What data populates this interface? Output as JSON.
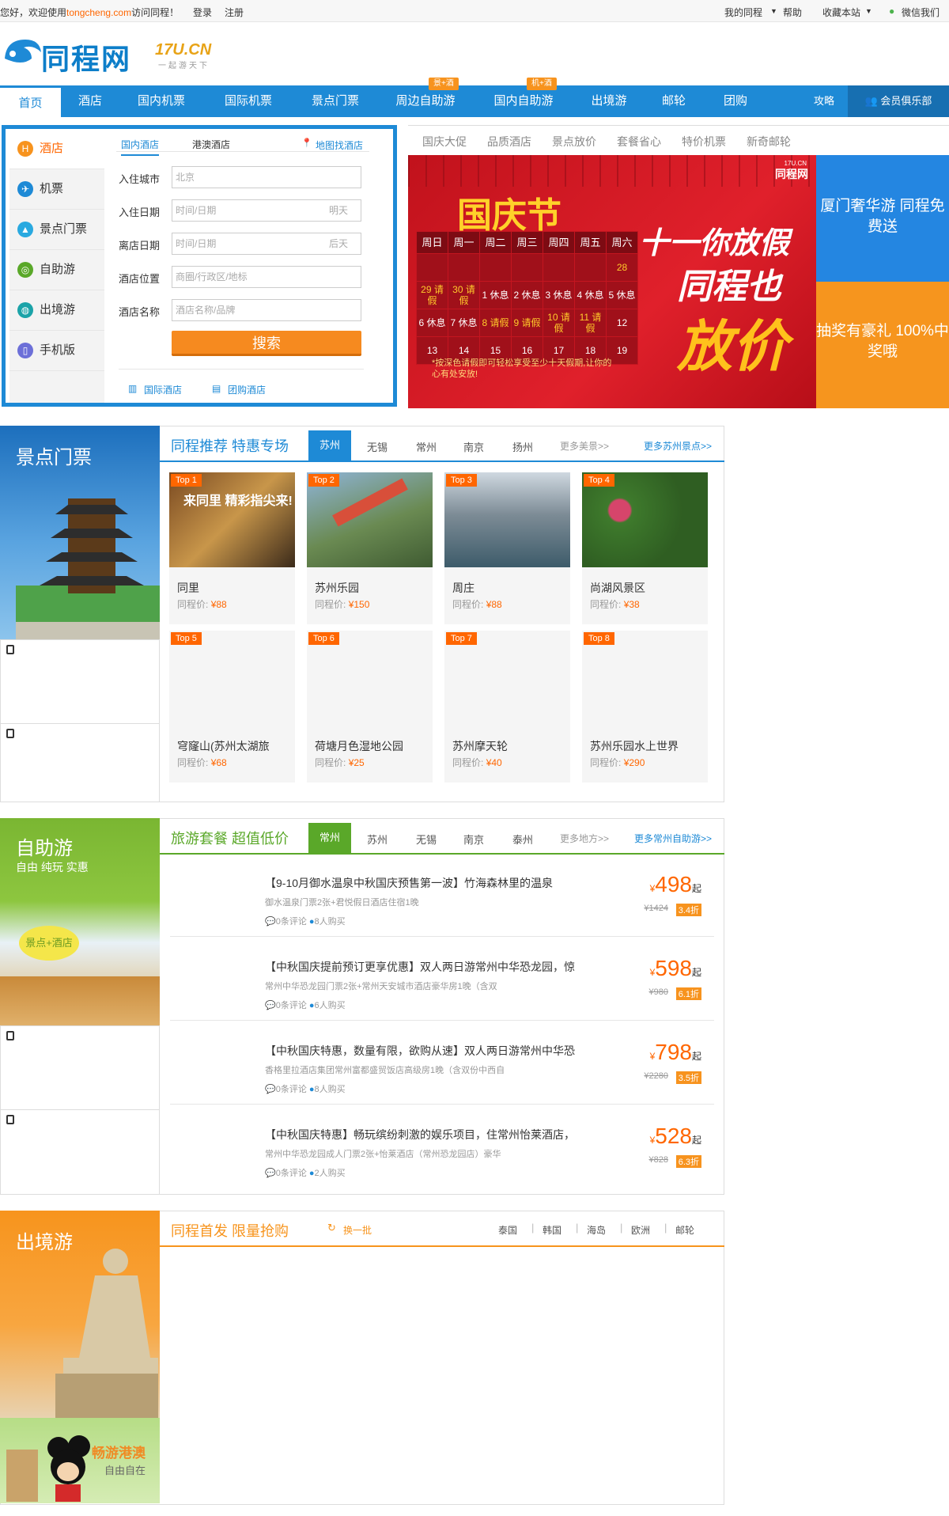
{
  "topbar": {
    "welcome": "您好，欢迎使用",
    "site": "tongcheng.com",
    "visit": "访问同程！",
    "login": "登录",
    "register": "注册",
    "my": "我的同程",
    "help": "帮助",
    "fav": "收藏本站",
    "wechat": "微信我们"
  },
  "logo": {
    "name": "同程网",
    "domain": "17U.CN",
    "slogan": "一起游天下"
  },
  "nav": {
    "items": [
      "首页",
      "酒店",
      "国内机票",
      "国际机票",
      "景点门票",
      "周边自助游",
      "国内自助游",
      "出境游",
      "邮轮",
      "团购"
    ],
    "badges": [
      "景+酒",
      "机+酒"
    ],
    "guide": "攻略",
    "club": "会员俱乐部"
  },
  "hotel": {
    "tabs": [
      "酒店",
      "机票",
      "景点门票",
      "自助游",
      "出境游",
      "手机版"
    ],
    "subtabs": [
      "国内酒店",
      "港澳酒店",
      "地图找酒店"
    ],
    "labels": [
      "入住城市",
      "入住日期",
      "离店日期",
      "酒店位置",
      "酒店名称"
    ],
    "city": "北京",
    "date_ph": "时间/日期",
    "tomorrow": "明天",
    "after": "后天",
    "loc_ph": "商圈/行政区/地标",
    "name_ph": "酒店名称/品牌",
    "search": "搜索",
    "intl": "国际酒店",
    "group": "团购酒店"
  },
  "promo": {
    "tabs": [
      "国庆大促",
      "品质酒店",
      "景点放价",
      "套餐省心",
      "特价机票",
      "新奇邮轮"
    ],
    "title": "国庆节",
    "brand": "同程网",
    "brand_domain": "17U.CN",
    "slogan1": "十一你放假",
    "slogan2": "同程也",
    "slogan3": "放价",
    "note": "*按深色请假即可轻松享受至少十天假期,让你的心有处安放!",
    "days": [
      "周日",
      "周一",
      "周二",
      "周三",
      "周四",
      "周五",
      "周六"
    ],
    "rows": [
      [
        "",
        "",
        "",
        "",
        "",
        "",
        "28"
      ],
      [
        "29 请假",
        "30 请假",
        "1 休息",
        "2 休息",
        "3 休息",
        "4 休息",
        "5 休息"
      ],
      [
        "6 休息",
        "7 休息",
        "8 请假",
        "9 请假",
        "10 请假",
        "11 请假",
        "12"
      ],
      [
        "13",
        "14",
        "15",
        "16",
        "17",
        "18",
        "19"
      ]
    ],
    "side1": "厦门奢华游 同程免费送",
    "side2": "抽奖有豪礼 100%中奖哦"
  },
  "scenic": {
    "title": "景点门票",
    "head": "同程推荐 特惠专场",
    "tabs": [
      "苏州",
      "无锡",
      "常州",
      "南京",
      "扬州",
      "更多美景>>"
    ],
    "more": "更多苏州景点>>",
    "price_label": "同程价:",
    "items": [
      {
        "top": "Top 1",
        "name": "同里",
        "price": "¥88"
      },
      {
        "top": "Top 2",
        "name": "苏州乐园",
        "price": "¥150"
      },
      {
        "top": "Top 3",
        "name": "周庄",
        "price": "¥88"
      },
      {
        "top": "Top 4",
        "name": "尚湖风景区",
        "price": "¥38"
      },
      {
        "top": "Top 5",
        "name": "穹窿山(苏州太湖旅",
        "price": "¥68"
      },
      {
        "top": "Top 6",
        "name": "荷塘月色湿地公园",
        "price": "¥25"
      },
      {
        "top": "Top 7",
        "name": "苏州摩天轮",
        "price": "¥40"
      },
      {
        "top": "Top 8",
        "name": "苏州乐园水上世界",
        "price": "¥290"
      }
    ],
    "poster_text": "来同里 精彩指尖来!"
  },
  "self": {
    "title": "自助游",
    "sub": "自由 纯玩 实惠",
    "bubble": "景点+酒店",
    "head": "旅游套餐 超值低价",
    "tabs": [
      "常州",
      "苏州",
      "无锡",
      "南京",
      "泰州",
      "更多地方>>"
    ],
    "more": "更多常州自助游>>",
    "items": [
      {
        "title": "【9-10月御水温泉中秋国庆预售第一波】竹海森林里的温泉",
        "desc": "御水温泉门票2张+君悦假日酒店住宿1晚",
        "comments": "0条评论",
        "buy": "8人购买",
        "price": "498",
        "orig": "¥1424",
        "disc": "3.4折"
      },
      {
        "title": "【中秋国庆提前预订更享优惠】双人两日游常州中华恐龙园，惊",
        "desc": "常州中华恐龙园门票2张+常州天安城市酒店豪华房1晚（含双",
        "comments": "0条评论",
        "buy": "6人购买",
        "price": "598",
        "orig": "¥980",
        "disc": "6.1折"
      },
      {
        "title": "【中秋国庆特惠，数量有限，欲购从速】双人两日游常州中华恐",
        "desc": "香格里拉酒店集团常州富都盛贸饭店高级房1晚（含双份中西自",
        "comments": "0条评论",
        "buy": "8人购买",
        "price": "798",
        "orig": "¥2280",
        "disc": "3.5折"
      },
      {
        "title": "【中秋国庆特惠】畅玩缤纷刺激的娱乐项目，住常州怡莱酒店，",
        "desc": "常州中华恐龙园成人门票2张+怡莱酒店（常州恐龙园店）豪华",
        "comments": "0条评论",
        "buy": "2人购买",
        "price": "528",
        "orig": "¥828",
        "disc": "6.3折"
      }
    ],
    "qi": "起",
    "yen": "¥"
  },
  "abroad": {
    "title": "出境游",
    "head": "同程首发 限量抢购",
    "refresh": "换一批",
    "tabs": [
      "泰国",
      "韩国",
      "海岛",
      "欧洲",
      "邮轮"
    ],
    "hk": "畅游港澳",
    "hk_sub": "自由自在"
  }
}
